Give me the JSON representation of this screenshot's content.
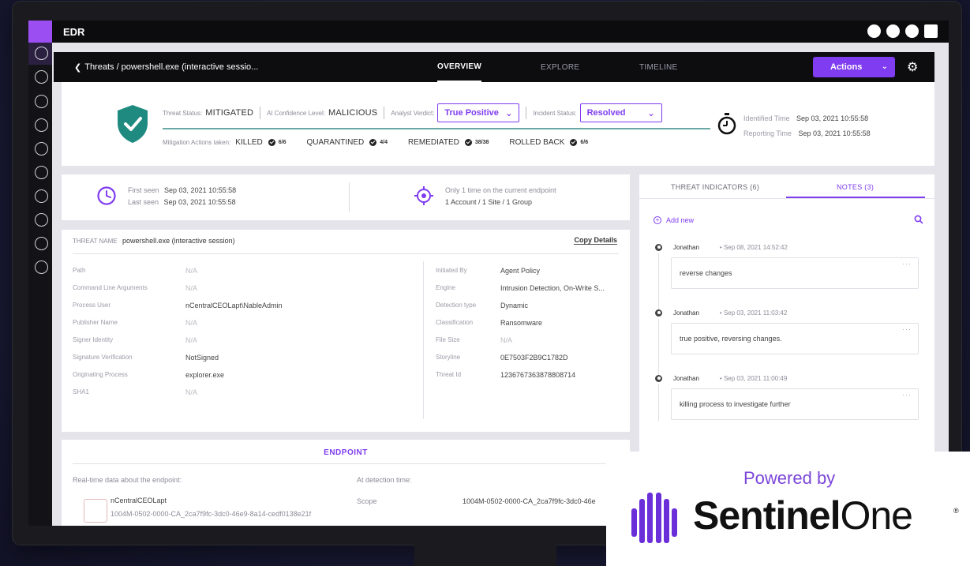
{
  "app": {
    "title": "EDR"
  },
  "topbar": {
    "breadcrumb": "Threats / powershell.exe (interactive sessio...",
    "tabs": [
      "OVERVIEW",
      "EXPLORE",
      "TIMELINE"
    ],
    "active_tab": "OVERVIEW",
    "actions_label": "Actions"
  },
  "status": {
    "threat_status_label": "Threat Status:",
    "threat_status_value": "MITIGATED",
    "ai_confidence_label": "AI Confidence Level:",
    "ai_confidence_value": "MALICIOUS",
    "analyst_verdict_label": "Analyst Verdict:",
    "analyst_verdict_value": "True Positive",
    "incident_status_label": "Incident Status:",
    "incident_status_value": "Resolved",
    "mitigation_label": "Mitigation Actions taken:",
    "mitigations": [
      {
        "name": "KILLED",
        "count": "6/6"
      },
      {
        "name": "QUARANTINED",
        "count": "4/4"
      },
      {
        "name": "REMEDIATED",
        "count": "38/38"
      },
      {
        "name": "ROLLED BACK",
        "count": "6/6"
      }
    ],
    "identified_label": "Identified Time",
    "identified_value": "Sep 03, 2021 10:55:58",
    "reporting_label": "Reporting Time",
    "reporting_value": "Sep 03, 2021 10:55:58"
  },
  "seen": {
    "first_label": "First seen",
    "first_value": "Sep 03, 2021 10:55:58",
    "last_label": "Last seen",
    "last_value": "Sep 03, 2021 10:55:58",
    "occurrence": "Only 1 time on the current endpoint",
    "scope": "1 Account / 1 Site / 1 Group"
  },
  "threat": {
    "name_label": "THREAT NAME",
    "name_value": "powershell.exe (interactive session)",
    "copy_label": "Copy Details",
    "left_fields": [
      {
        "label": "Path",
        "value": "N/A",
        "na": true
      },
      {
        "label": "Command Line Arguments",
        "value": "N/A",
        "na": true
      },
      {
        "label": "Process User",
        "value": "nCentralCEOLapt\\NableAdmin",
        "na": false
      },
      {
        "label": "Publisher Name",
        "value": "N/A",
        "na": true
      },
      {
        "label": "Signer Identity",
        "value": "N/A",
        "na": true
      },
      {
        "label": "Signature Verification",
        "value": "NotSigned",
        "na": false
      },
      {
        "label": "Originating Process",
        "value": "explorer.exe",
        "na": false
      },
      {
        "label": "SHA1",
        "value": "N/A",
        "na": true
      }
    ],
    "right_fields": [
      {
        "label": "Initiated By",
        "value": "Agent Policy",
        "na": false
      },
      {
        "label": "Engine",
        "value": "Intrusion Detection, On-Write S...",
        "na": false
      },
      {
        "label": "Detection type",
        "value": "Dynamic",
        "na": false
      },
      {
        "label": "Classification",
        "value": "Ransomware",
        "na": false
      },
      {
        "label": "File Size",
        "value": "N/A",
        "na": true
      },
      {
        "label": "Storyline",
        "value": "0E7503F2B9C1782D",
        "na": false
      },
      {
        "label": "Threat Id",
        "value": "1236767363878808714",
        "na": false
      }
    ]
  },
  "endpoint": {
    "title": "ENDPOINT",
    "realtime_label": "Real-time data about the endpoint:",
    "detection_label": "At detection time:",
    "name": "nCentralCEOLapt",
    "id": "1004M-0502-0000-CA_2ca7f9fc-3dc0-46e9-8a14-cedf0138e21f",
    "scope_label": "Scope",
    "scope_value": "1004M-0502-0000-CA_2ca7f9fc-3dc0-46e"
  },
  "notes_panel": {
    "tabs": [
      "THREAT INDICATORS (6)",
      "NOTES (3)"
    ],
    "active_tab": "NOTES (3)",
    "add_new": "Add new",
    "notes": [
      {
        "author": "Jonathan",
        "time": "• Sep 08, 2021 14:52:42",
        "text": "reverse changes"
      },
      {
        "author": "Jonathan",
        "time": "• Sep 03, 2021 11:03:42",
        "text": "true positive, reversing changes."
      },
      {
        "author": "Jonathan",
        "time": "• Sep 03, 2021 11:00:49",
        "text": "killing process to investigate further"
      }
    ]
  },
  "badge": {
    "powered_by": "Powered by",
    "brand_bold": "Sentinel",
    "brand_light": "One",
    "reg": "®"
  },
  "colors": {
    "accent": "#7f3cf0",
    "shield": "#1f8a80",
    "brand_purple": "#7b45d9"
  }
}
